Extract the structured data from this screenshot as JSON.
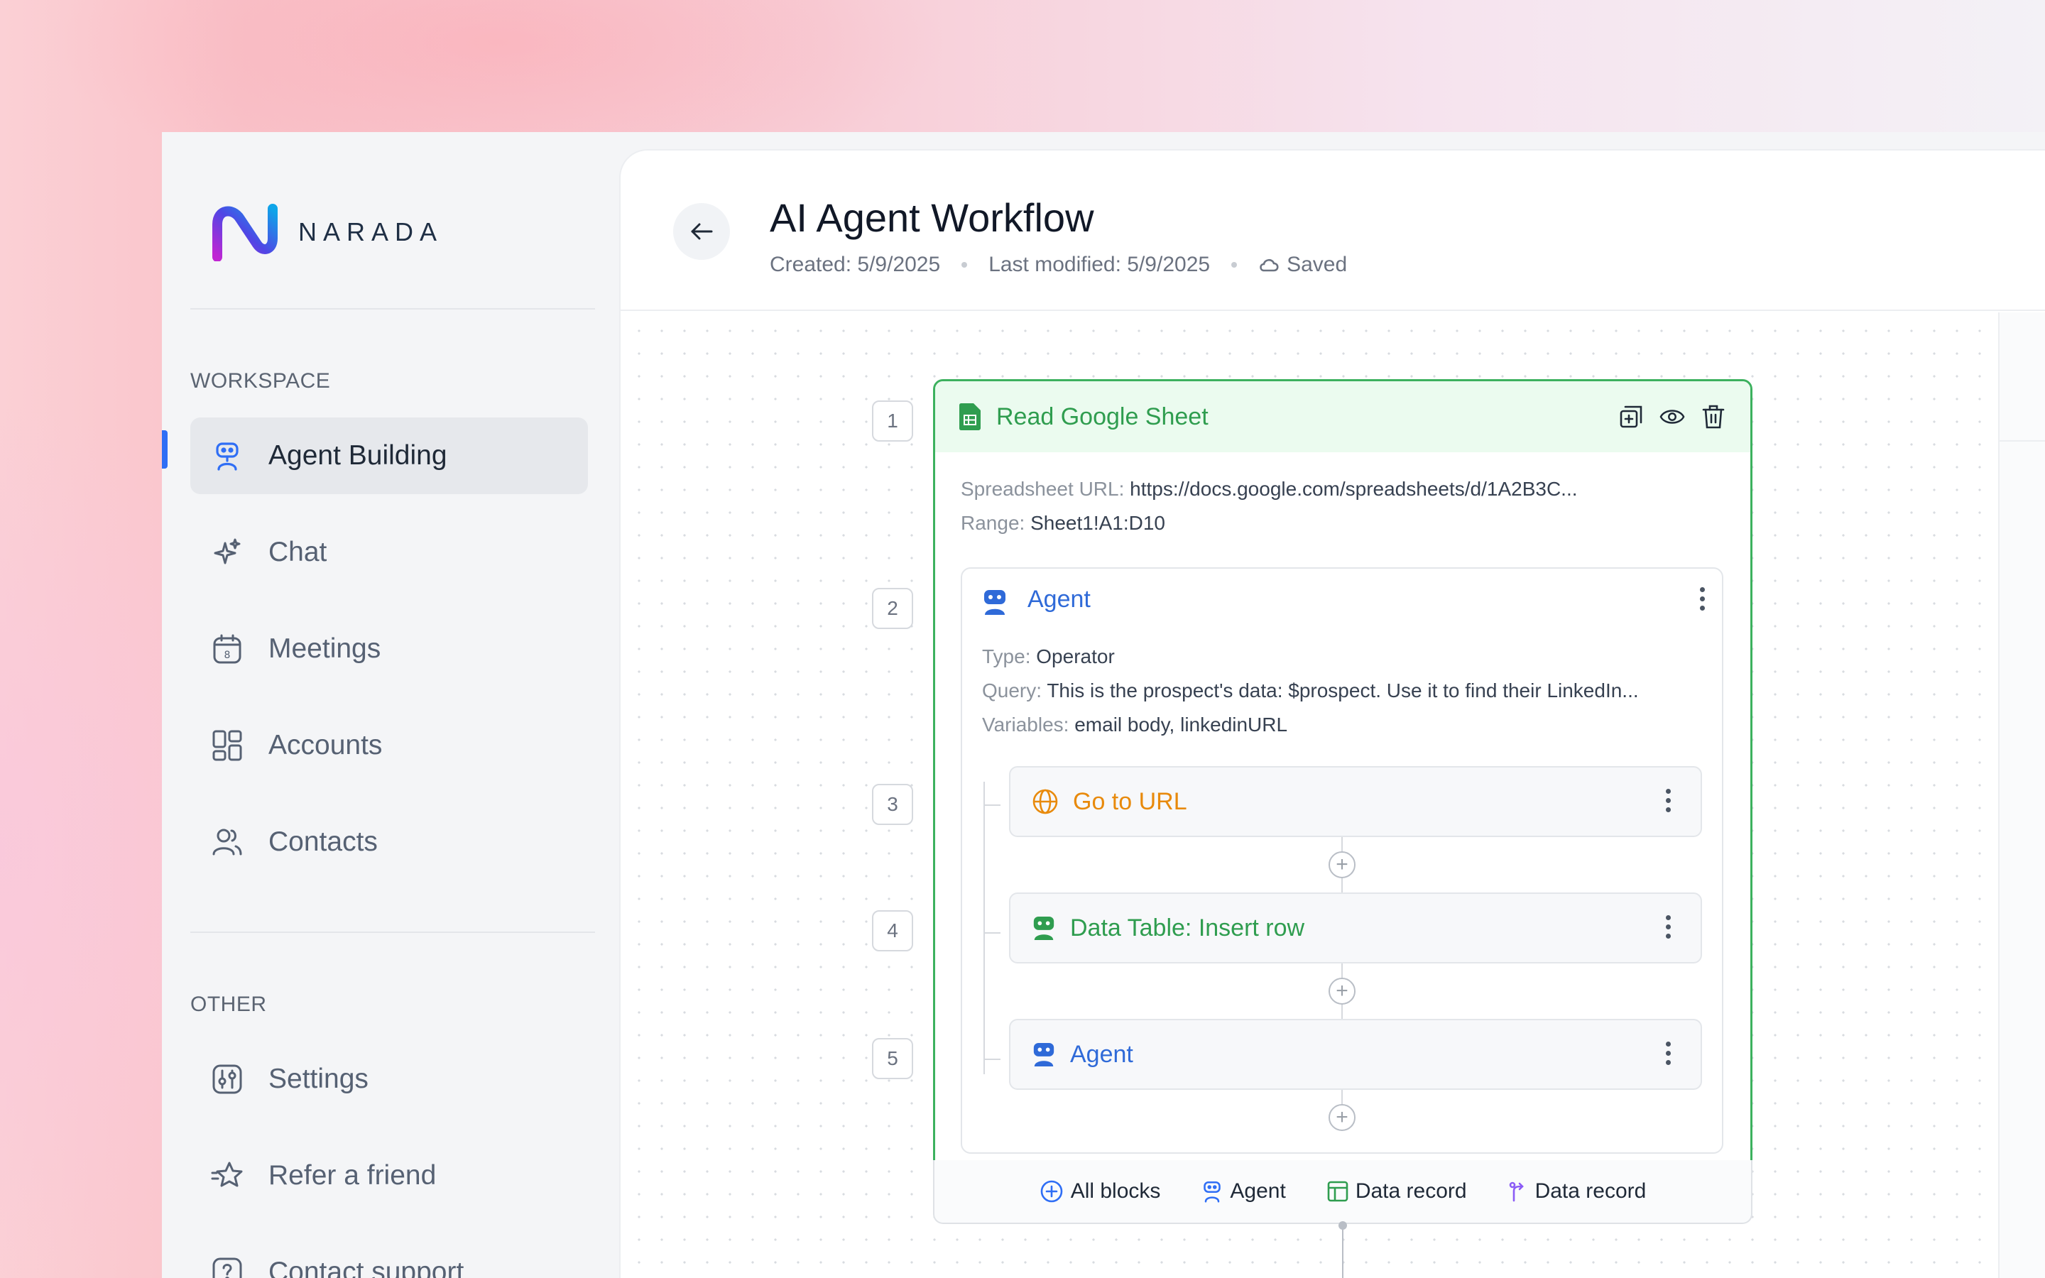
{
  "brand": {
    "name": "NARADA"
  },
  "sidebar": {
    "workspace_label": "WORKSPACE",
    "other_label": "OTHER",
    "workspace_items": [
      {
        "label": "Agent Building",
        "icon": "robot-icon"
      },
      {
        "label": "Chat",
        "icon": "sparkle-icon"
      },
      {
        "label": "Meetings",
        "icon": "calendar-icon"
      },
      {
        "label": "Accounts",
        "icon": "grid-icon"
      },
      {
        "label": "Contacts",
        "icon": "people-icon"
      }
    ],
    "other_items": [
      {
        "label": "Settings",
        "icon": "sliders-icon"
      },
      {
        "label": "Refer a friend",
        "icon": "star-icon"
      },
      {
        "label": "Contact support",
        "icon": "help-icon"
      }
    ]
  },
  "header": {
    "title": "AI Agent Workflow",
    "created": "Created: 5/9/2025",
    "modified": "Last modified: 5/9/2025",
    "status": "Saved"
  },
  "workflow": {
    "steps": [
      "1",
      "2",
      "3",
      "4",
      "5"
    ],
    "sheet": {
      "title": "Read Google Sheet",
      "url_label": "Spreadsheet URL:",
      "url_value": "https://docs.google.com/spreadsheets/d/1A2B3C...",
      "range_label": "Range:",
      "range_value": "Sheet1!A1:D10"
    },
    "agent": {
      "title": "Agent",
      "type_label": "Type:",
      "type_value": "Operator",
      "query_label": "Query:",
      "query_value": "This is the prospect's data: $prospect. Use it to find their LinkedIn...",
      "variables_label": "Variables:",
      "variables_value": "email body, linkedinURL"
    },
    "sub_steps": [
      {
        "title": "Go to URL",
        "color": "#e88a0c",
        "icon": "globe-icon"
      },
      {
        "title": "Data Table: Insert row",
        "color": "#2f9d4f",
        "icon": "robot-icon"
      },
      {
        "title": "Agent",
        "color": "#2f6ad8",
        "icon": "robot-icon"
      }
    ]
  },
  "toolbar": {
    "items": [
      {
        "label": "All blocks",
        "icon": "plus-circle-icon"
      },
      {
        "label": "Agent",
        "icon": "robot-icon"
      },
      {
        "label": "Data record",
        "icon": "table-icon"
      },
      {
        "label": "Data record",
        "icon": "branch-icon"
      }
    ]
  },
  "colors": {
    "accent": "#2f6ef5",
    "sheet_green": "#3cb15e",
    "agent_blue": "#2f6ad8",
    "url_orange": "#e88a0c"
  }
}
